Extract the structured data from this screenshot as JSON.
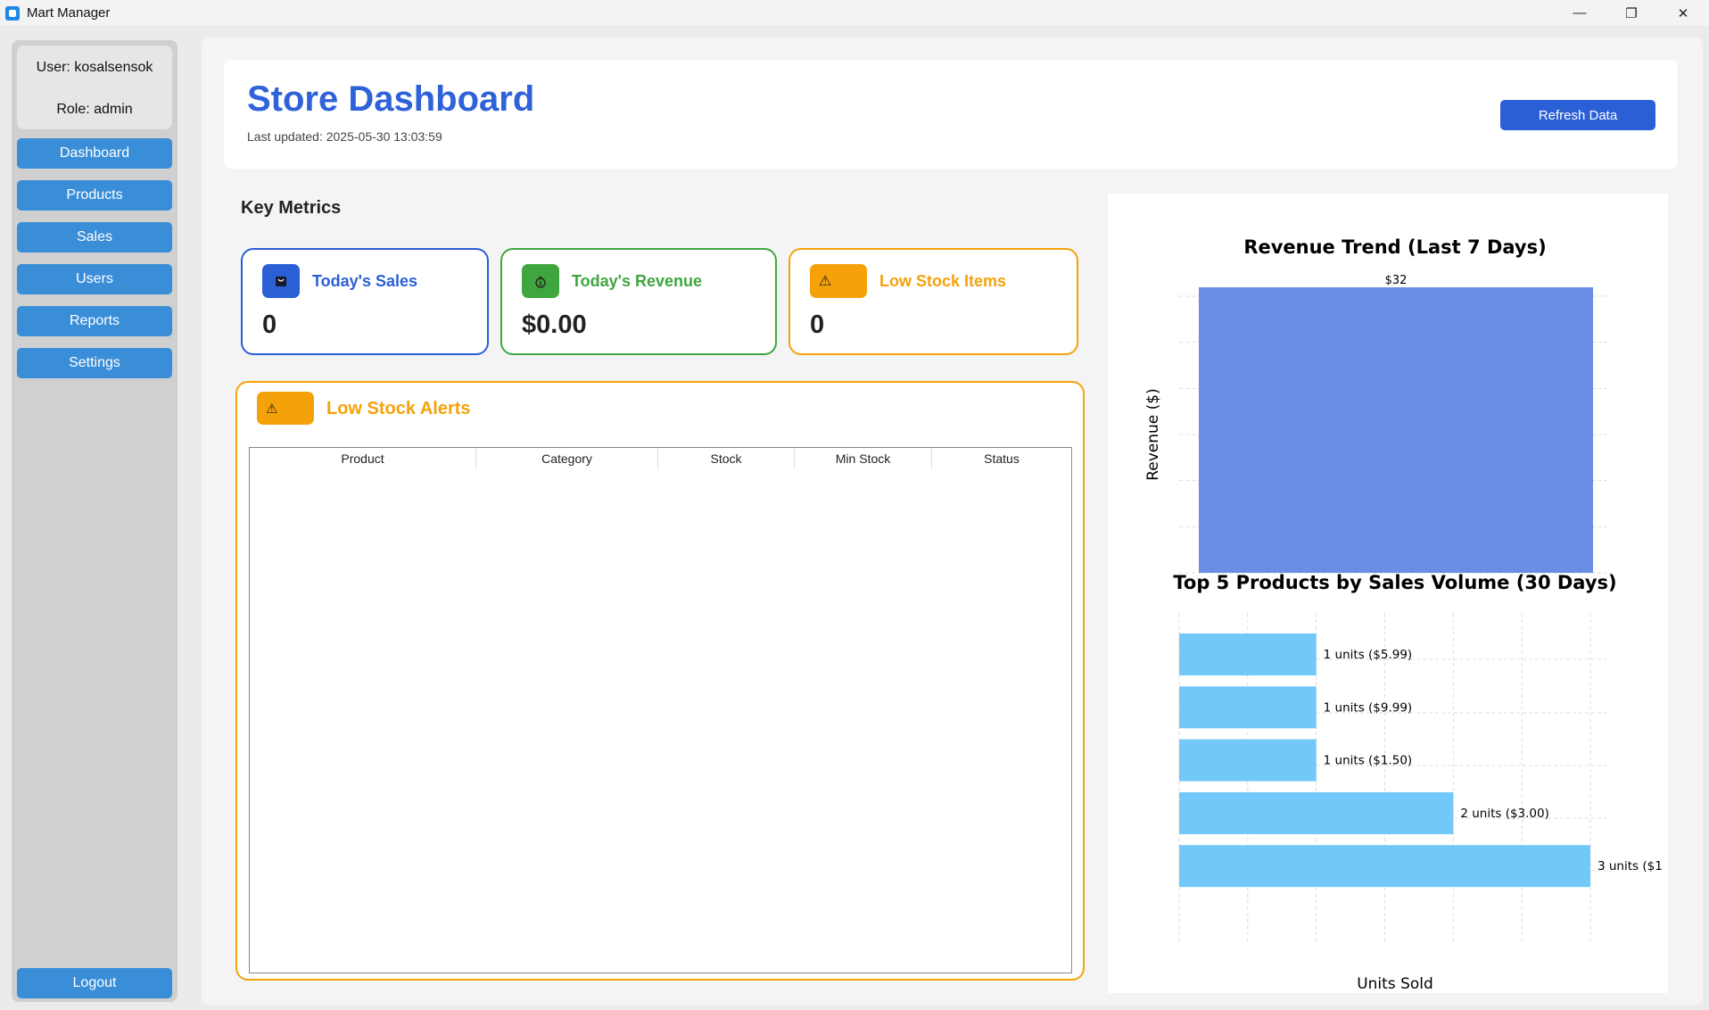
{
  "window": {
    "title": "Mart Manager"
  },
  "sidebar": {
    "user": "User: kosalsensok",
    "role": "Role: admin",
    "items": [
      {
        "label": "Dashboard"
      },
      {
        "label": "Products"
      },
      {
        "label": "Sales"
      },
      {
        "label": "Users"
      },
      {
        "label": "Reports"
      },
      {
        "label": "Settings"
      }
    ],
    "logout": "Logout"
  },
  "header": {
    "title": "Store Dashboard",
    "last_updated": "Last updated: 2025-05-30 13:03:59",
    "refresh": "Refresh Data"
  },
  "metrics": {
    "title": "Key Metrics",
    "cards": [
      {
        "label": "Today's Sales",
        "value": "0",
        "color": "#2a5fd6",
        "icon": "shopping-bag-icon"
      },
      {
        "label": "Today's Revenue",
        "value": "$0.00",
        "color": "#3fa63f",
        "icon": "money-bag-icon"
      },
      {
        "label": "Low Stock Items",
        "value": "0",
        "color": "#f5a20a",
        "icon": "warning-icon"
      }
    ]
  },
  "alerts": {
    "title": "Low Stock Alerts",
    "icon": "warning-icon",
    "columns": [
      "Product",
      "Category",
      "Stock",
      "Min Stock",
      "Status"
    ],
    "rows": []
  },
  "chart_data": [
    {
      "type": "bar",
      "title": "Revenue Trend (Last 7 Days)",
      "ylabel": "Revenue ($)",
      "xlabel": "",
      "categories": [
        ""
      ],
      "values": [
        32
      ],
      "data_labels": [
        "$32"
      ],
      "color": "#6a8ee6",
      "grid": true
    },
    {
      "type": "bar",
      "orientation": "horizontal",
      "title": "Top 5 Products by Sales Volume (30 Days)",
      "xlabel": "Units Sold",
      "ylabel": "",
      "values": [
        1,
        1,
        1,
        2,
        3
      ],
      "data_labels": [
        "1 units ($5.99)",
        "1 units ($9.99)",
        "1 units ($1.50)",
        "2 units ($3.00)",
        "3 units ($1"
      ],
      "xlim": [
        0,
        3
      ],
      "color": "#73c8fa",
      "grid": true
    }
  ],
  "colors": {
    "accent": "#2f62d8",
    "nav": "#3a8ed8",
    "warning": "#f5a20a",
    "success": "#3fa63f"
  }
}
